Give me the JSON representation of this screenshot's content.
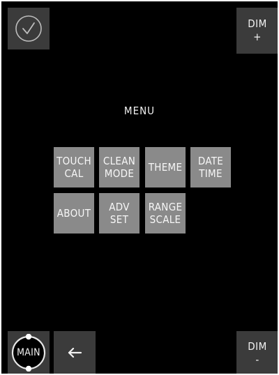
{
  "colors": {
    "background": "#000000",
    "corner_button": "#3b3b3b",
    "menu_button": "#8a8a8a",
    "text": "#f2f2f2"
  },
  "top_bar": {
    "confirm_icon": "checkmark-circle-icon",
    "dim_plus_line1": "DIM",
    "dim_plus_line2": "+"
  },
  "menu": {
    "title": "MENU",
    "buttons": [
      {
        "line1": "TOUCH",
        "line2": "CAL"
      },
      {
        "line1": "CLEAN",
        "line2": "MODE"
      },
      {
        "line1": "THEME",
        "line2": ""
      },
      {
        "line1": "DATE",
        "line2": "TIME"
      },
      {
        "line1": "ABOUT",
        "line2": ""
      },
      {
        "line1": "ADV",
        "line2": "SET"
      },
      {
        "line1": "RANGE",
        "line2": "SCALE"
      }
    ]
  },
  "bottom_bar": {
    "main_label": "MAIN",
    "back_icon": "left-arrow-icon",
    "dim_minus_line1": "DIM",
    "dim_minus_line2": "-"
  }
}
